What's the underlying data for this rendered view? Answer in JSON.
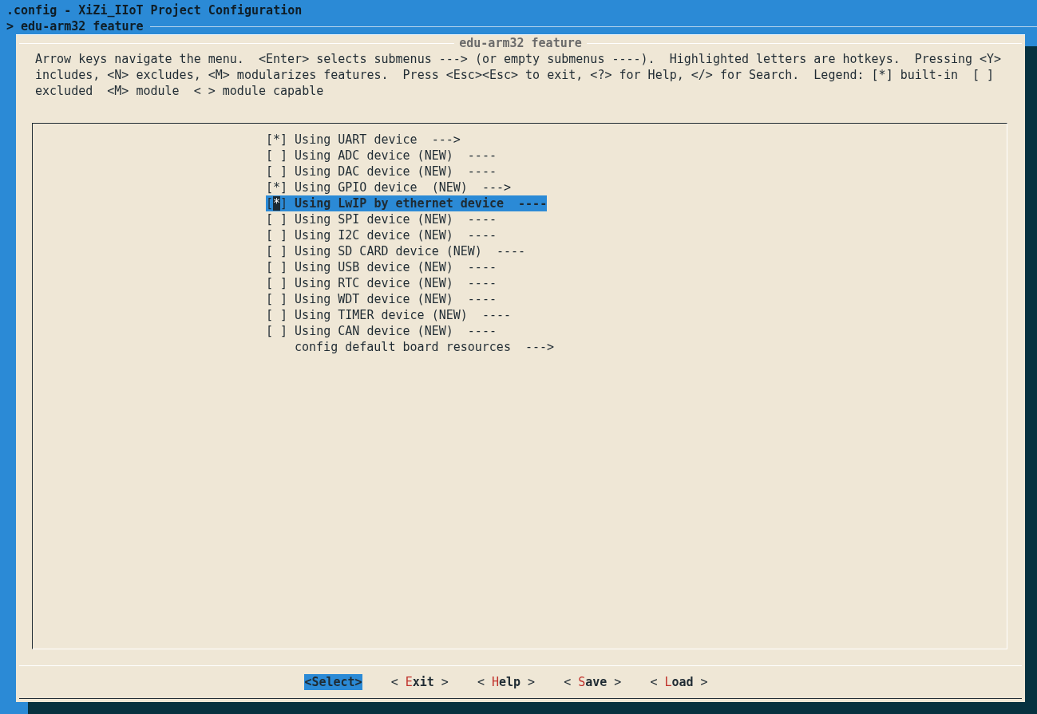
{
  "window": {
    "title": ".config - XiZi_IIoT Project Configuration",
    "breadcrumb": "> edu-arm32 feature"
  },
  "dialog": {
    "title": "edu-arm32 feature",
    "help_lines": [
      "Arrow keys navigate the menu.  <Enter> selects submenus ---> (or empty submenus ----).  Highlighted letters are hotkeys.  Pressing <Y>",
      "includes, <N> excludes, <M> modularizes features.  Press <Esc><Esc> to exit, <?> for Help, </> for Search.  Legend: [*] built-in  [ ]",
      "excluded  <M> module  < > module capable"
    ],
    "items": [
      {
        "kind": "bool",
        "box": "[*]",
        "label": "Using UART device  --->",
        "selected": false
      },
      {
        "kind": "bool",
        "box": "[ ]",
        "label": "Using ADC device (NEW)  ----",
        "selected": false
      },
      {
        "kind": "bool",
        "box": "[ ]",
        "label": "Using DAC device (NEW)  ----",
        "selected": false
      },
      {
        "kind": "bool",
        "box": "[*]",
        "label": "Using GPIO device  (NEW)  --->",
        "selected": false
      },
      {
        "kind": "bool",
        "box": "[*]",
        "label": "Using LwIP by ethernet device  ----",
        "selected": true
      },
      {
        "kind": "bool",
        "box": "[ ]",
        "label": "Using SPI device (NEW)  ----",
        "selected": false
      },
      {
        "kind": "bool",
        "box": "[ ]",
        "label": "Using I2C device (NEW)  ----",
        "selected": false
      },
      {
        "kind": "bool",
        "box": "[ ]",
        "label": "Using SD CARD device (NEW)  ----",
        "selected": false
      },
      {
        "kind": "bool",
        "box": "[ ]",
        "label": "Using USB device (NEW)  ----",
        "selected": false
      },
      {
        "kind": "bool",
        "box": "[ ]",
        "label": "Using RTC device (NEW)  ----",
        "selected": false
      },
      {
        "kind": "bool",
        "box": "[ ]",
        "label": "Using WDT device (NEW)  ----",
        "selected": false
      },
      {
        "kind": "bool",
        "box": "[ ]",
        "label": "Using TIMER device (NEW)  ----",
        "selected": false
      },
      {
        "kind": "bool",
        "box": "[ ]",
        "label": "Using CAN device (NEW)  ----",
        "selected": false
      },
      {
        "kind": "menu",
        "label": "config default board resources  --->",
        "selected": false
      }
    ],
    "buttons": [
      {
        "label": "<Select>",
        "selected": true
      },
      {
        "before": "< ",
        "hotkey": "E",
        "after": "xit >",
        "selected": false
      },
      {
        "before": "< ",
        "hotkey": "H",
        "after": "elp >",
        "selected": false
      },
      {
        "before": "< ",
        "hotkey": "S",
        "after": "ave >",
        "selected": false
      },
      {
        "before": "< ",
        "hotkey": "L",
        "after": "oad >",
        "selected": false
      }
    ]
  }
}
